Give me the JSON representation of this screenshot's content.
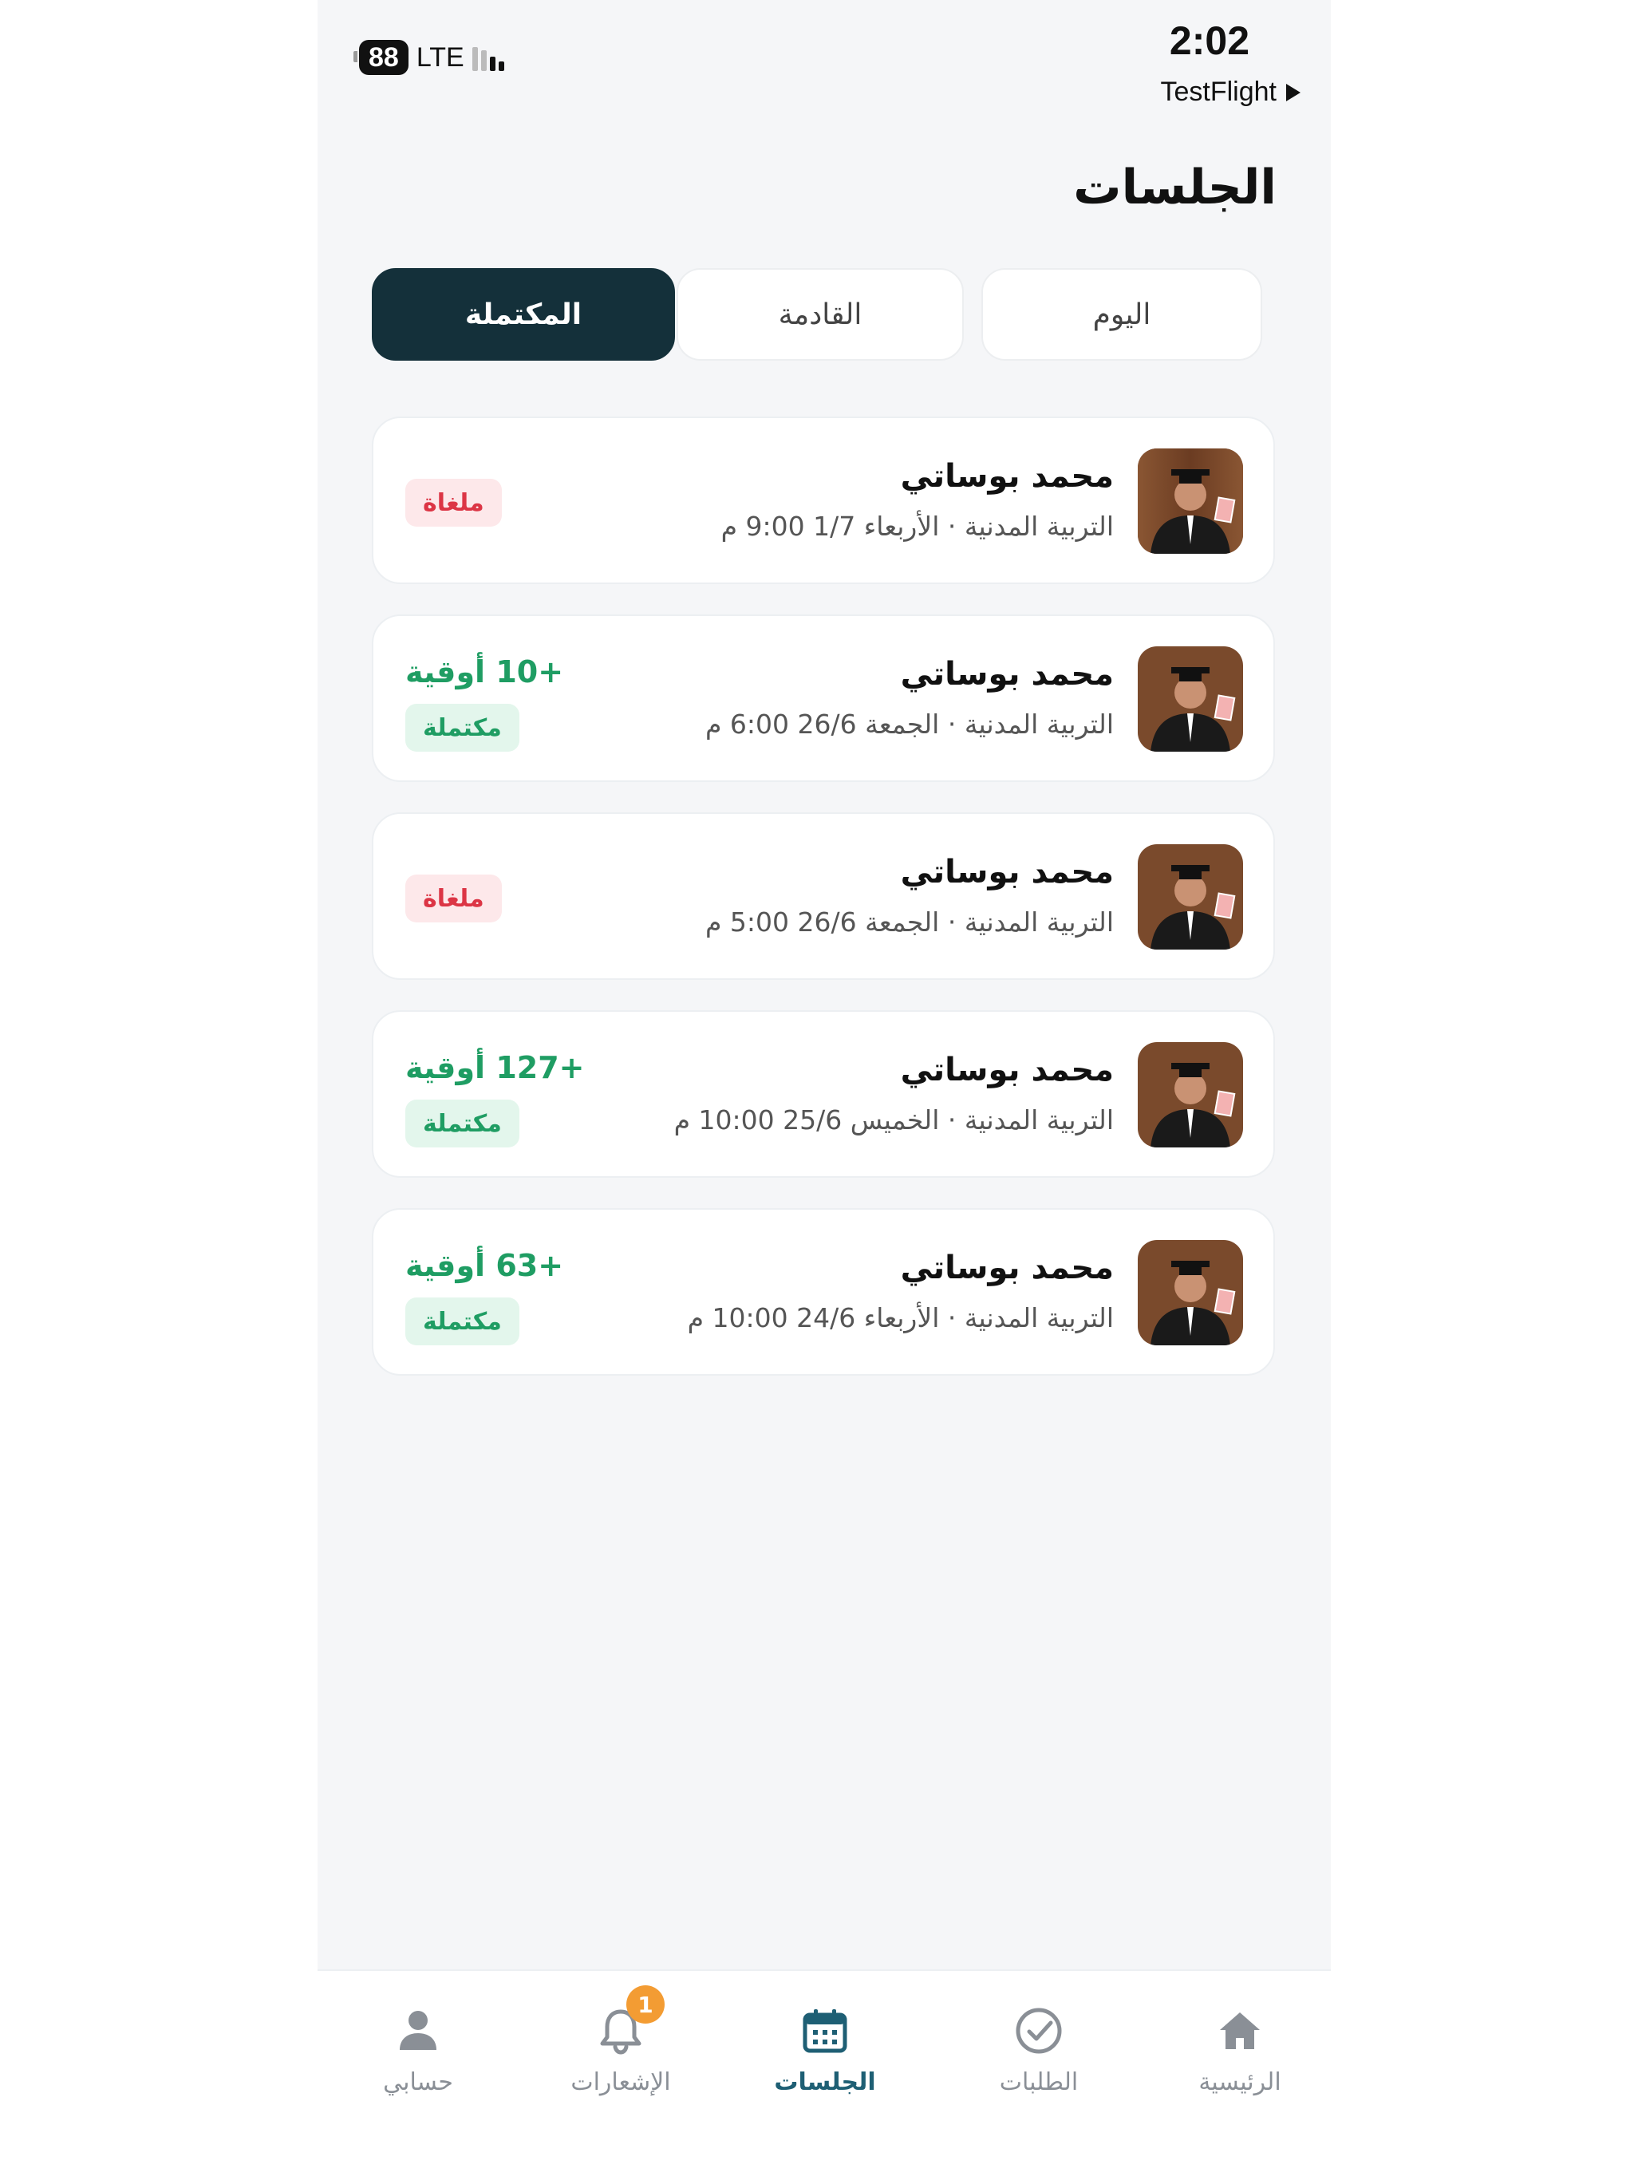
{
  "status_bar": {
    "time": "2:02",
    "back_app": "TestFlight",
    "battery": "88",
    "network": "LTE"
  },
  "page_title": "الجلسات",
  "tabs": [
    {
      "label": "اليوم",
      "active": false
    },
    {
      "label": "القادمة",
      "active": false
    },
    {
      "label": "المكتملة",
      "active": true
    }
  ],
  "sessions": [
    {
      "name": "محمد بوساتي",
      "meta": "التربية المدنية · الأربعاء 1/7 9:00 م",
      "amount": "",
      "status": "ملغاة",
      "status_type": "cancelled"
    },
    {
      "name": "محمد بوساتي",
      "meta": "التربية المدنية · الجمعة 26/6 6:00 م",
      "amount": "+10 أوقية",
      "status": "مكتملة",
      "status_type": "completed"
    },
    {
      "name": "محمد بوساتي",
      "meta": "التربية المدنية · الجمعة 26/6 5:00 م",
      "amount": "",
      "status": "ملغاة",
      "status_type": "cancelled"
    },
    {
      "name": "محمد بوساتي",
      "meta": "التربية المدنية · الخميس 25/6 10:00 م",
      "amount": "+127 أوقية",
      "status": "مكتملة",
      "status_type": "completed"
    },
    {
      "name": "محمد بوساتي",
      "meta": "التربية المدنية · الأربعاء 24/6 10:00 م",
      "amount": "+63 أوقية",
      "status": "مكتملة",
      "status_type": "completed"
    }
  ],
  "bottom_nav": {
    "home": "الرئيسية",
    "requests": "الطلبات",
    "sessions": "الجلسات",
    "notifications": "الإشعارات",
    "notifications_count": "1",
    "account": "حسابي"
  },
  "colors": {
    "primary_dark": "#14303a",
    "accent": "#1e5f74",
    "success": "#1f9d63",
    "danger": "#dc3545",
    "badge_orange": "#f39c33"
  }
}
